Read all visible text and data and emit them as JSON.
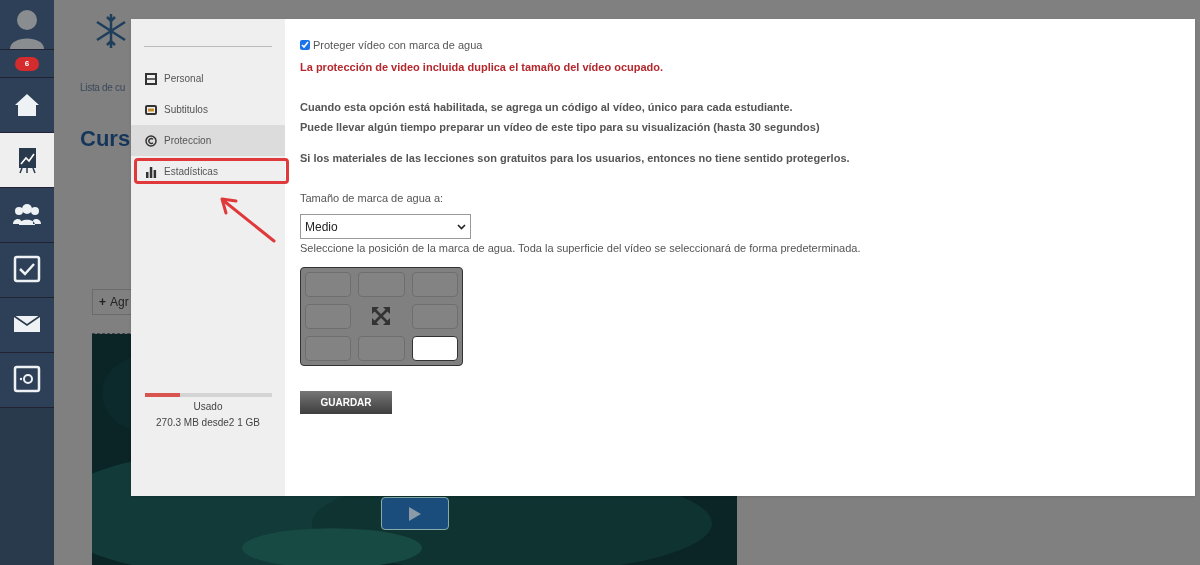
{
  "nav": {
    "badge": "6",
    "items": [
      {
        "kind": "home",
        "selected": false
      },
      {
        "kind": "chart",
        "selected": true
      },
      {
        "kind": "people",
        "selected": false
      },
      {
        "kind": "check",
        "selected": false
      },
      {
        "kind": "mail",
        "selected": false
      },
      {
        "kind": "safe",
        "selected": false
      }
    ]
  },
  "page": {
    "breadcrumb": "Lista de cu",
    "title": "Curs",
    "add_icon": "+",
    "add_button": "Agr"
  },
  "modal": {
    "menu": [
      {
        "label": "Personal",
        "kind": "film",
        "selected": false
      },
      {
        "label": "Subtitulos",
        "kind": "cc",
        "selected": false
      },
      {
        "label": "Proteccion",
        "kind": "copyright",
        "selected": true
      },
      {
        "label": "Estadísticas",
        "kind": "bars",
        "selected": false,
        "highlighted": true
      }
    ],
    "storage": {
      "level": 0.28,
      "label": "Usado",
      "reading": "270.3 MB desde2 1 GB"
    },
    "protect": {
      "label": "Proteger vídeo con marca de agua",
      "checked": true
    },
    "warning": "La protección de video incluida duplica el tamaño del vídeo ocupado.",
    "info": [
      "Cuando esta opción está habilitada, se agrega un código al vídeo, único para cada estudiante.",
      "Puede llevar algún tiempo preparar un vídeo de este tipo para su visualización (hasta 30 segundos)"
    ],
    "note": "Si los materiales de las lecciones son gratuitos para los usuarios, entonces no tiene sentido protegerlos.",
    "size_label": "Tamaño de marca de agua a:",
    "size_value": "Medio",
    "position_help": "Seleccione la posición de la marca de agua. Toda la superficie del vídeo se seleccionará de forma predeterminada.",
    "positions": [
      {
        "kind": "cell",
        "selected": false
      },
      {
        "kind": "cell",
        "selected": false
      },
      {
        "kind": "cell",
        "selected": false
      },
      {
        "kind": "cell",
        "selected": false
      },
      {
        "kind": "all",
        "selected": false
      },
      {
        "kind": "cell",
        "selected": false
      },
      {
        "kind": "cell",
        "selected": false
      },
      {
        "kind": "cell",
        "selected": false
      },
      {
        "kind": "cell",
        "selected": true
      }
    ],
    "save": "GUARDAR"
  }
}
